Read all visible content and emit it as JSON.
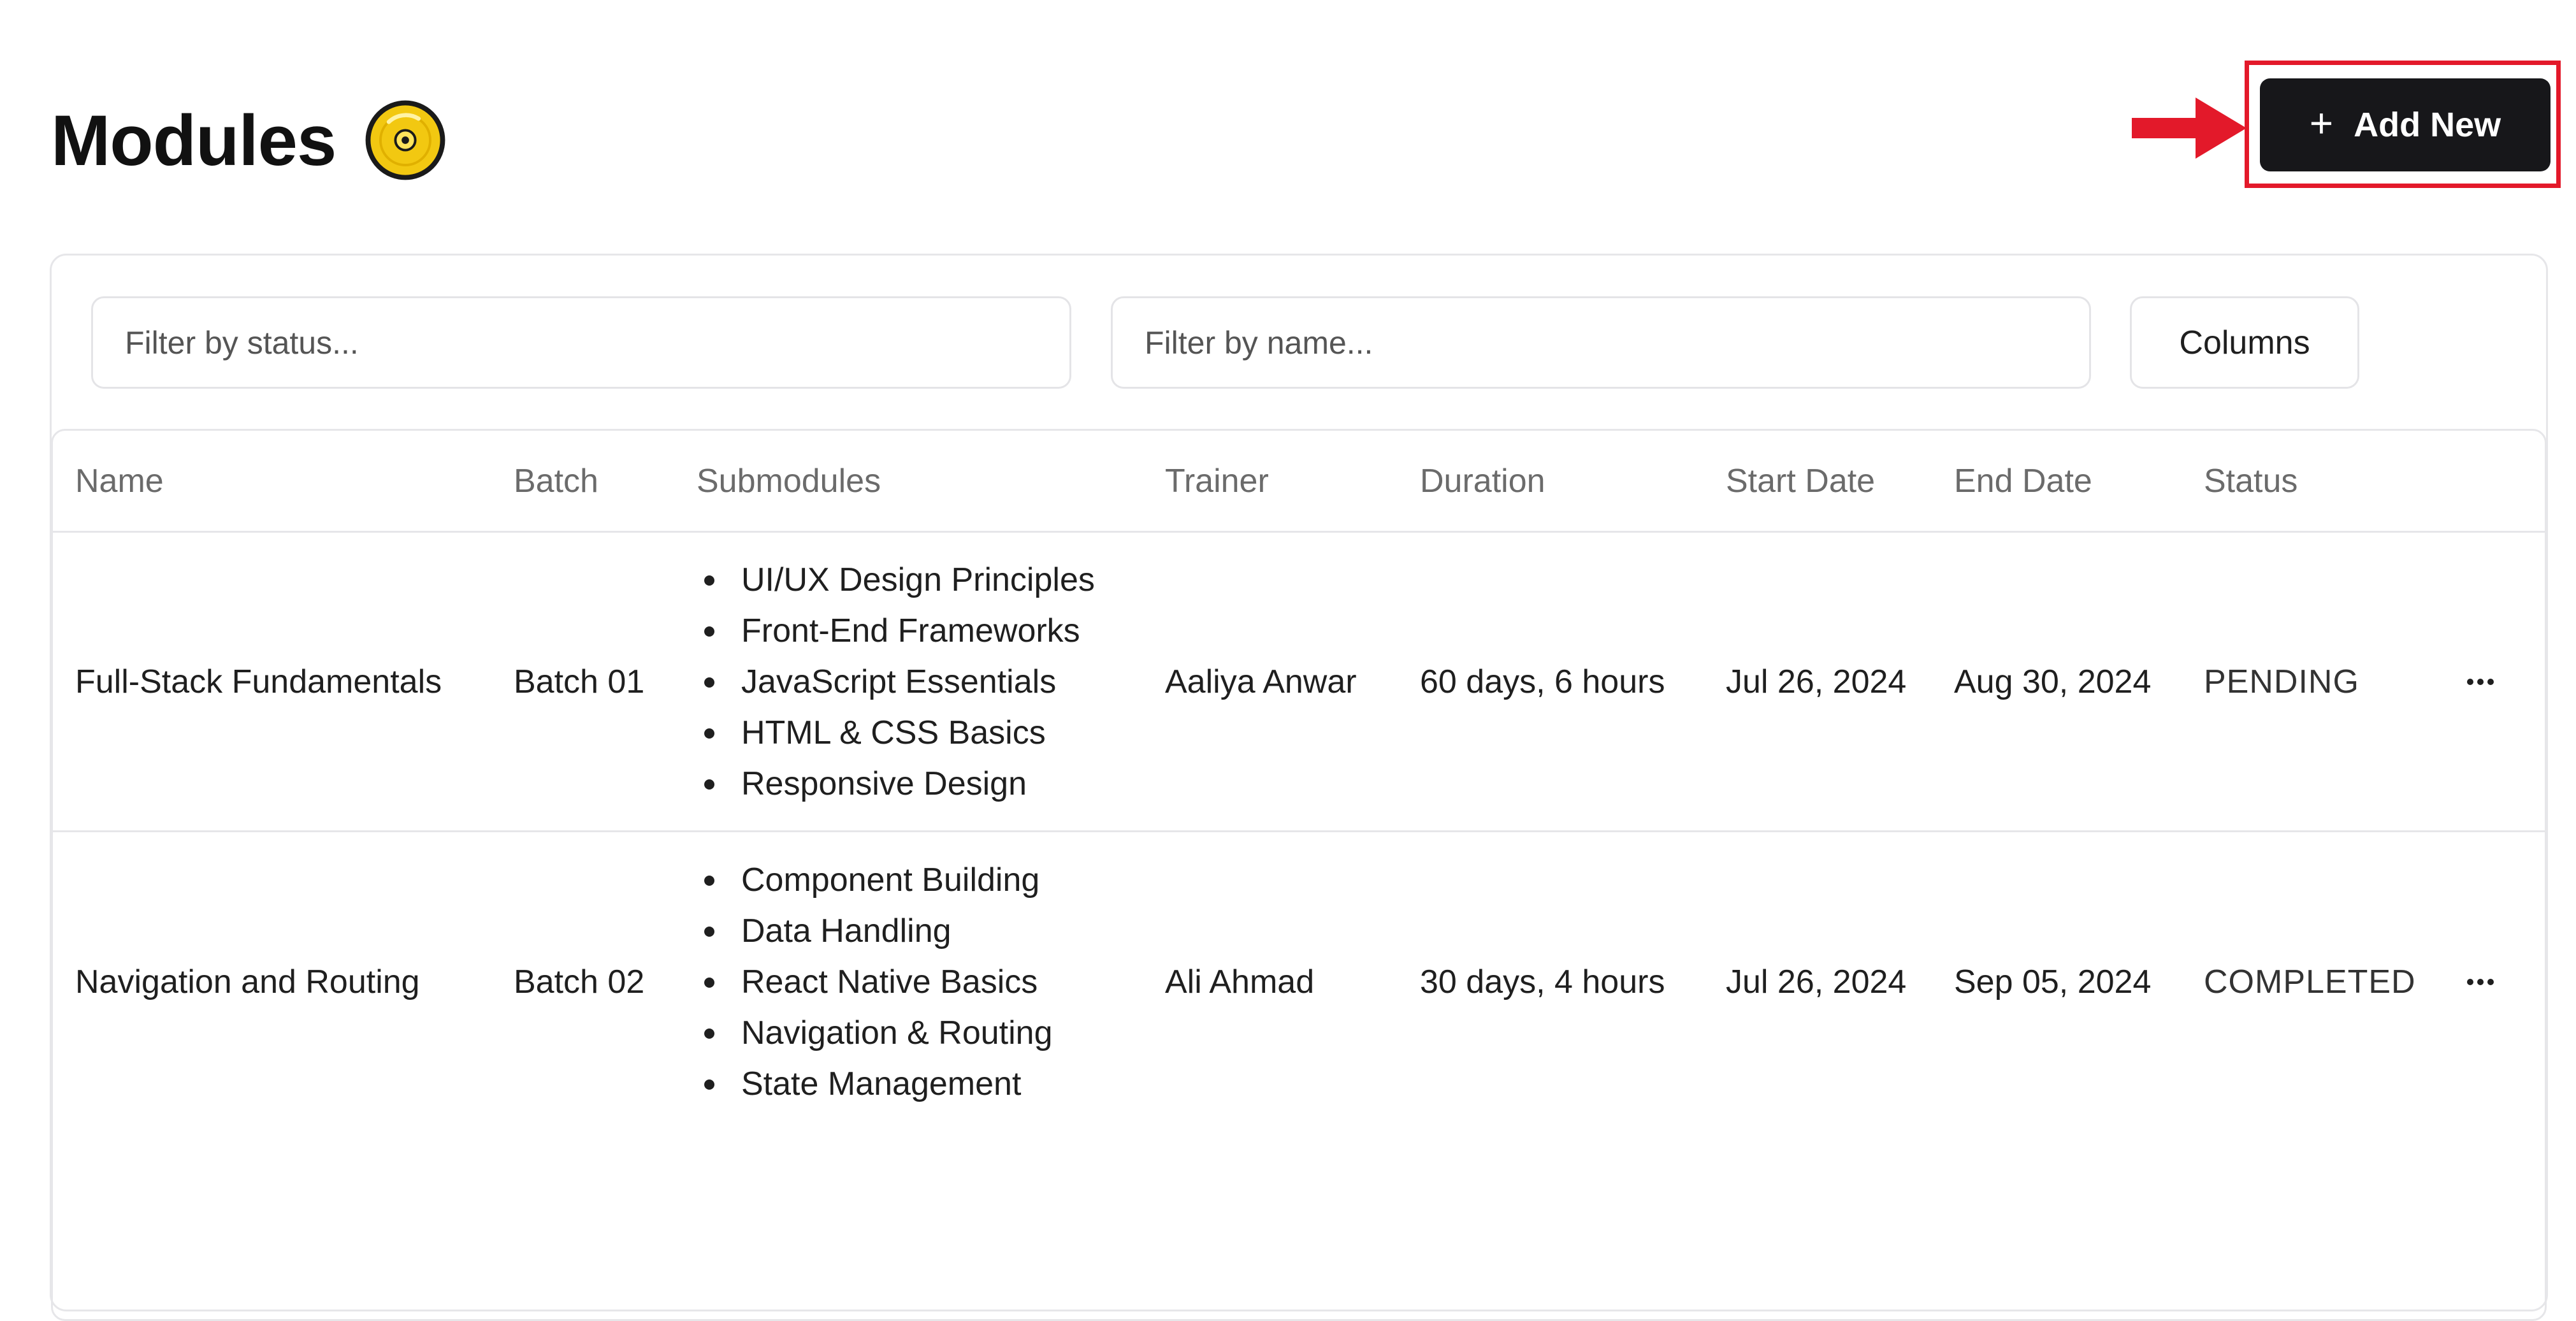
{
  "page": {
    "title": "Modules",
    "title_icon": "disc-icon"
  },
  "toolbar": {
    "add_button_icon": "plus-icon",
    "add_button_label": "Add New",
    "annotation": "red-arrow-and-highlight"
  },
  "filters": {
    "status_placeholder": "Filter by status...",
    "status_value": "",
    "name_placeholder": "Filter by name...",
    "name_value": "",
    "columns_label": "Columns"
  },
  "table": {
    "columns": [
      "Name",
      "Batch",
      "Submodules",
      "Trainer",
      "Duration",
      "Start Date",
      "End Date",
      "Status"
    ],
    "rows": [
      {
        "name": "Full-Stack Fundamentals",
        "batch": "Batch 01",
        "submodules": [
          "UI/UX Design Principles",
          "Front-End Frameworks",
          "JavaScript Essentials",
          "HTML & CSS Basics",
          "Responsive Design"
        ],
        "trainer": "Aaliya Anwar",
        "duration": "60 days, 6 hours",
        "start_date": "Jul 26, 2024",
        "end_date": "Aug 30, 2024",
        "status": "PENDING",
        "actions_icon": "more-horizontal-icon"
      },
      {
        "name": "Navigation and Routing",
        "batch": "Batch 02",
        "submodules": [
          "Component Building",
          "Data Handling",
          "React Native Basics",
          "Navigation & Routing",
          "State Management"
        ],
        "trainer": "Ali Ahmad",
        "duration": "30 days, 4 hours",
        "start_date": "Jul 26, 2024",
        "end_date": "Sep 05, 2024",
        "status": "COMPLETED",
        "actions_icon": "more-horizontal-icon"
      }
    ]
  },
  "colors": {
    "primary_button": "#17171a",
    "annotation_red": "#e3192a",
    "disc_icon_yellow": "#f2c811",
    "border": "#e6e6e9",
    "muted_text": "#6b6b6b"
  }
}
